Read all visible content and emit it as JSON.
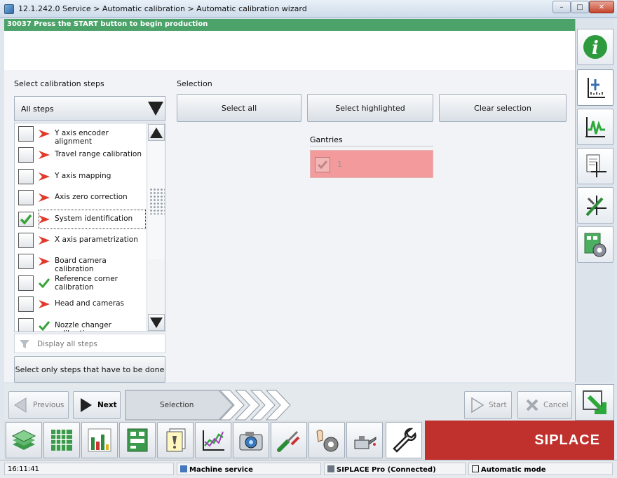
{
  "window": {
    "title": "12.1.242.0 Service > Automatic calibration > Automatic calibration wizard",
    "minimize": "–",
    "maximize": "□",
    "close": "✕"
  },
  "message": "30037 Press the START button to begin production",
  "left_panel": {
    "section_label": "Select calibration steps",
    "dropdown_value": "All steps",
    "steps": [
      {
        "label": "Y axis encoder alignment",
        "checked": false,
        "status": "todo"
      },
      {
        "label": "Travel range calibration",
        "checked": false,
        "status": "todo"
      },
      {
        "label": "Y axis mapping",
        "checked": false,
        "status": "todo"
      },
      {
        "label": "Axis zero correction",
        "checked": false,
        "status": "todo"
      },
      {
        "label": "System identification",
        "checked": true,
        "status": "todo"
      },
      {
        "label": "X axis parametrization",
        "checked": false,
        "status": "todo"
      },
      {
        "label": "Board camera calibration",
        "checked": false,
        "status": "todo"
      },
      {
        "label": "Reference corner calibration",
        "checked": false,
        "status": "done"
      },
      {
        "label": "Head and cameras",
        "checked": false,
        "status": "todo"
      },
      {
        "label": "Nozzle changer calibration",
        "checked": false,
        "status": "done"
      }
    ],
    "display_all": "Display all steps",
    "select_todo": "Select only steps that have to be done"
  },
  "selection": {
    "section_label": "Selection",
    "select_all": "Select all",
    "select_highlighted": "Select highlighted",
    "clear_selection": "Clear selection",
    "gantries_label": "Gantries",
    "gantry_number": "1"
  },
  "nav": {
    "previous": "Previous",
    "next": "Next",
    "current_step": "Selection",
    "start": "Start",
    "cancel": "Cancel"
  },
  "brand": "SIPLACE",
  "status": {
    "time": "16:11:41",
    "mode": "Machine service",
    "connection": "SIPLACE Pro (Connected)",
    "automation": "Automatic mode"
  },
  "colors": {
    "message_bar": "#4ca36a",
    "brand": "#c0302c",
    "gantry_highlight": "#f29a9c",
    "arrow_red": "#e23b2e",
    "check_green": "#3aa33a"
  }
}
